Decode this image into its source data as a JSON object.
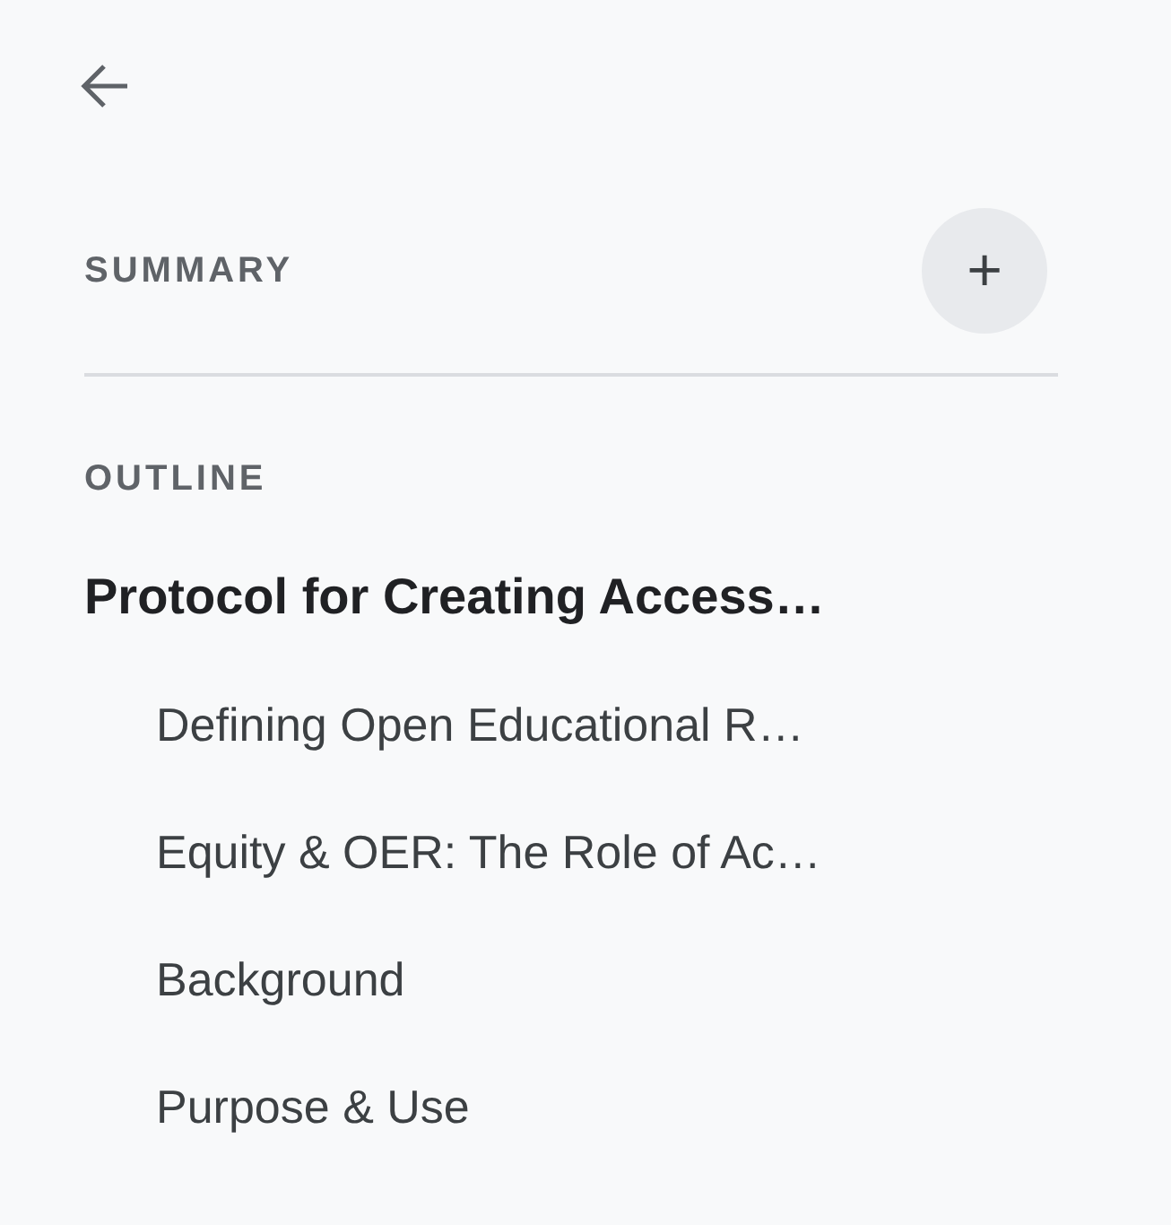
{
  "summary": {
    "title": "SUMMARY",
    "add_label": "+"
  },
  "outline": {
    "title": "OUTLINE",
    "items": [
      {
        "text": "Protocol for Creating Access…",
        "children": [
          {
            "text": "Defining Open Educational R…"
          },
          {
            "text": "Equity & OER: The Role of Ac…"
          },
          {
            "text": "Background"
          },
          {
            "text": "Purpose & Use"
          }
        ]
      }
    ]
  }
}
